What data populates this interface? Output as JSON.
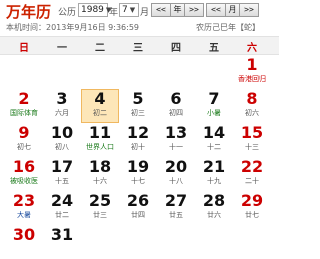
{
  "header": {
    "logo": "万年历",
    "calendar_type_label": "公历",
    "year_value": "1989",
    "year_suffix": "年",
    "month_value": "7",
    "month_suffix": "月",
    "nav_buttons": [
      "<<",
      "年",
      ">>",
      "<<",
      "月",
      ">>"
    ],
    "local_time": "本机时间：2013年9月16日 9:36:59",
    "lunar_info": "农历己巳年【蛇】"
  },
  "weekdays": [
    "日",
    "一",
    "二",
    "三",
    "四",
    "五",
    "六"
  ],
  "weeks": [
    [
      {
        "day": "",
        "sub": ""
      },
      {
        "day": "",
        "sub": ""
      },
      {
        "day": "",
        "sub": ""
      },
      {
        "day": "",
        "sub": ""
      },
      {
        "day": "",
        "sub": ""
      },
      {
        "day": "",
        "sub": ""
      },
      {
        "day": "1",
        "sub": "香港回归",
        "style": "fest"
      }
    ],
    [
      {
        "day": "2",
        "sub": "国际体育",
        "style": "term"
      },
      {
        "day": "3",
        "sub": "六月"
      },
      {
        "day": "4",
        "sub": "初二",
        "today": true
      },
      {
        "day": "5",
        "sub": "初三"
      },
      {
        "day": "6",
        "sub": "初四"
      },
      {
        "day": "7",
        "sub": "小暑",
        "style": "term"
      },
      {
        "day": "8",
        "sub": "初六"
      }
    ],
    [
      {
        "day": "9",
        "sub": "初七"
      },
      {
        "day": "10",
        "sub": "初八"
      },
      {
        "day": "11",
        "sub": "世界人口",
        "style": "term"
      },
      {
        "day": "12",
        "sub": "初十"
      },
      {
        "day": "13",
        "sub": "十一"
      },
      {
        "day": "14",
        "sub": "十二"
      },
      {
        "day": "15",
        "sub": "十三"
      }
    ],
    [
      {
        "day": "16",
        "sub": "被吸收医",
        "style": "term"
      },
      {
        "day": "17",
        "sub": "十五"
      },
      {
        "day": "18",
        "sub": "十六"
      },
      {
        "day": "19",
        "sub": "十七"
      },
      {
        "day": "20",
        "sub": "十八"
      },
      {
        "day": "21",
        "sub": "十九"
      },
      {
        "day": "22",
        "sub": "二十"
      }
    ],
    [
      {
        "day": "23",
        "sub": "大暑",
        "style": "blue"
      },
      {
        "day": "24",
        "sub": "廿二"
      },
      {
        "day": "25",
        "sub": "廿三"
      },
      {
        "day": "26",
        "sub": "廿四"
      },
      {
        "day": "27",
        "sub": "廿五"
      },
      {
        "day": "28",
        "sub": "廿六"
      },
      {
        "day": "29",
        "sub": "廿七"
      }
    ],
    [
      {
        "day": "30",
        "sub": ""
      },
      {
        "day": "31",
        "sub": ""
      },
      {
        "day": "",
        "sub": ""
      },
      {
        "day": "",
        "sub": ""
      },
      {
        "day": "",
        "sub": ""
      },
      {
        "day": "",
        "sub": ""
      },
      {
        "day": "",
        "sub": ""
      }
    ]
  ],
  "colors": {
    "accent_red": "#cc0000",
    "today_bg": "#fde6b8",
    "solar_term_green": "#1a7a1a"
  }
}
